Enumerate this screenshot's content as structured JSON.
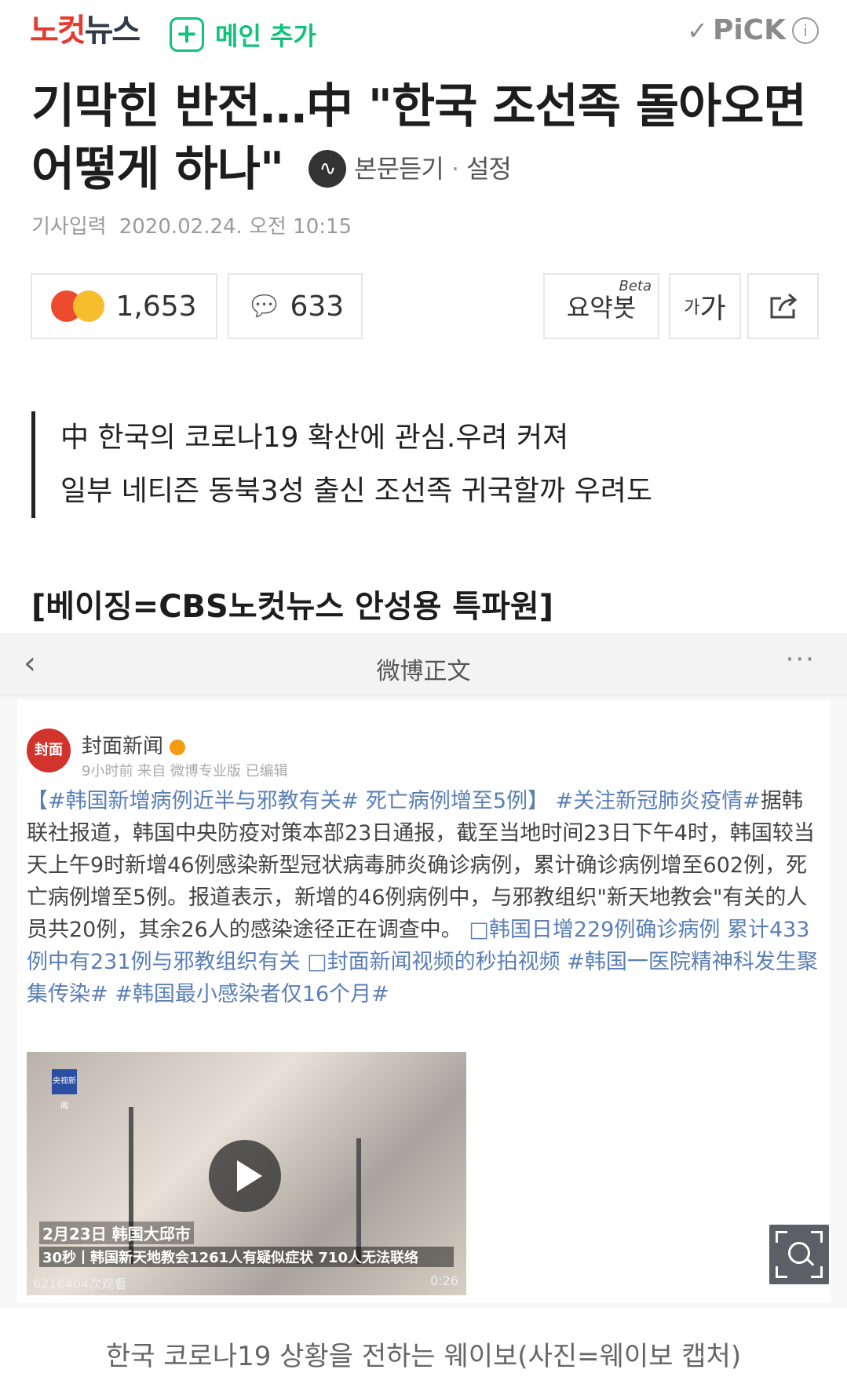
{
  "header": {
    "logo_red": "노컷",
    "logo_dark": "뉴스",
    "plus_icon": "+",
    "main_add_label": "메인 추가",
    "pick_check": "✓",
    "pick_label": "PiCK",
    "info_icon": "i"
  },
  "article": {
    "title": "기막힌 반전…中 \"한국 조선족 돌아오면 어떻게 하나\"",
    "listen_label": "본문듣기",
    "settings_label": "설정",
    "date_label": "기사입력",
    "date_value": "2020.02.24. 오전 10:15"
  },
  "actions": {
    "reaction_count": "1,653",
    "comment_count": "633",
    "summary_label": "요약봇",
    "summary_badge": "Beta",
    "font_small": "가",
    "font_large": "가",
    "share_icon": "share-icon"
  },
  "summary": {
    "line1": "中 한국의 코로나19 확산에 관심.우려 커져",
    "line2": "일부 네티즌 동북3성 출신 조선족 귀국할까 우려도"
  },
  "byline": "[베이징=CBS노컷뉴스 안성용 특파원]",
  "weibo": {
    "back_icon": "‹",
    "title": "微博正文",
    "more_icon": "···",
    "avatar_text": "封面",
    "account_name": "封面新闻",
    "account_meta": "9小时前 来自 微博专业版 已编辑",
    "post_tag1": "【#韩国新增病例近半与邪教有关# 死亡病例增至5例】",
    "post_tag2": "#关注新冠肺炎疫情#",
    "post_text": "据韩联社报道，韩国中央防疫对策本部23日通报，截至当地时间23日下午4时，韩国较当天上午9时新增46例感染新型冠状病毒肺炎确诊病例，累计确诊病例增至602例，死亡病例增至5例。报道表示，新增的46例病例中，与邪教组织\"新天地教会\"有关的人员共20例，其余26人的感染途径正在调查中。",
    "post_links": "□韩国日增229例确诊病例 累计433例中有231例与邪教组织有关 □封面新闻视频的秒拍视频 #韩国一医院精神科发生聚集传染# #韩国最小感染者仅16个月#",
    "video_logo": "央视新闻",
    "video_caption1": "2月23日 韩国大邱市",
    "video_caption2": "30秒丨韩国新天地教会1261人有疑似症状 710人无法联络",
    "video_views": "6216404次观看",
    "video_duration": "0:26"
  },
  "photo_caption": "한국 코로나19 상황을 전하는 웨이보(사진=웨이보 캡처)"
}
